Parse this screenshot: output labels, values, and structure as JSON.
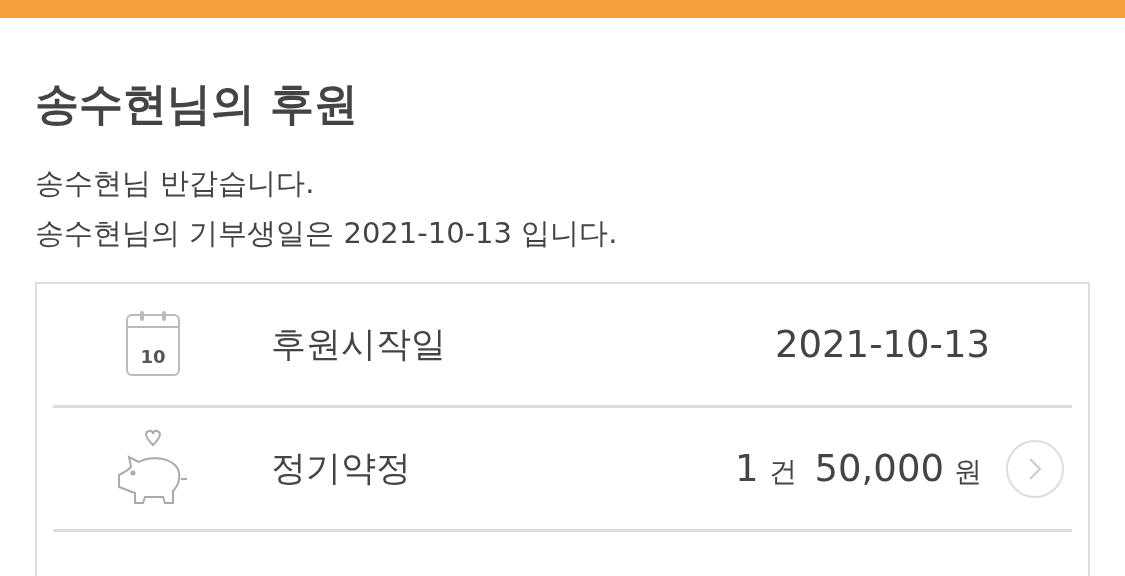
{
  "title": "송수현님의 후원",
  "greeting": [
    "송수현님 반갑습니다.",
    "송수현님의 기부생일은 2021-10-13 입니다."
  ],
  "rows": [
    {
      "kind": "date",
      "icon_text": "10",
      "label": "후원시작일",
      "value": [
        {
          "text": "2021-10-13",
          "unit": false
        }
      ]
    },
    {
      "kind": "pledge",
      "label": "정기약정",
      "value": [
        {
          "text": "1",
          "unit": false
        },
        {
          "text": "건",
          "unit": true
        },
        {
          "text": "50,000",
          "unit": false
        },
        {
          "text": "원",
          "unit": true
        }
      ]
    }
  ]
}
